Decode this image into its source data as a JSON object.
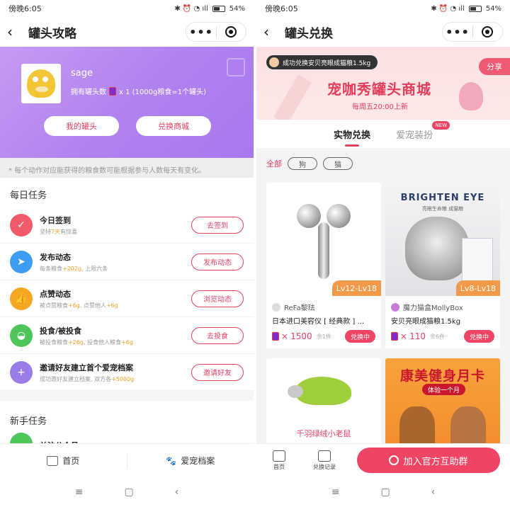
{
  "left": {
    "status": {
      "time": "傍晚6:05",
      "battery": "54%"
    },
    "nav": {
      "back_icon": "‹",
      "title": "罐头攻略",
      "more_icon": "•••"
    },
    "profile": {
      "username": "sage",
      "cans_text": "拥有罐头数",
      "cans_detail": "x 1 (1000g粮食=1个罐头)",
      "btn_my_cans": "我的罐头",
      "btn_shop": "兑换商城"
    },
    "notice": "* 每个动作对应能获得的粮食数可能根据参与人数每天有变化。",
    "daily_title": "每日任务",
    "tasks": [
      {
        "name": "今日签到",
        "desc_a": "坚持",
        "desc_hl": "7天",
        "desc_b": "有惊喜",
        "desc_hl2": "",
        "btn": "去签到",
        "color": "#f05a6b",
        "icon": "✓"
      },
      {
        "name": "发布动态",
        "desc_a": "每条粮食",
        "desc_hl": "+202g",
        "desc_b": ", 上限六条",
        "desc_hl2": "",
        "btn": "发布动态",
        "color": "#3d9df2",
        "icon": "➤"
      },
      {
        "name": "点赞动态",
        "desc_a": "被点赞粮食",
        "desc_hl": "+6g",
        "desc_b": ", 点赞他人",
        "desc_hl2": "+6g",
        "btn": "浏览动态",
        "color": "#f5a623",
        "icon": "👍"
      },
      {
        "name": "投食/被投食",
        "desc_a": "被投食粮食",
        "desc_hl": "+26g",
        "desc_b": ", 投食他人粮食",
        "desc_hl2": "+6g",
        "btn": "去投食",
        "color": "#4fc65a",
        "icon": "◒"
      },
      {
        "name": "邀请好友建立首个爱宠档案",
        "desc_a": "成功邀好友建立档案, 双方各",
        "desc_hl": "+5000g",
        "desc_b": "",
        "desc_hl2": "",
        "btn": "邀请好友",
        "color": "#9a7ce8",
        "icon": "+"
      }
    ],
    "newbie_title": "新手任务",
    "newbie_first": "关注公众号",
    "tabbar": {
      "home": "首页",
      "pets": "爱宠档案"
    }
  },
  "right": {
    "status": {
      "time": "傍晚6:05",
      "battery": "54%"
    },
    "nav": {
      "back_icon": "‹",
      "title": "罐头兑换",
      "more_icon": "•••"
    },
    "banner": {
      "toast": "成功兑换安贝亮眼成猫粮1.5kg",
      "share": "分享",
      "title": "宠咖秀罐头商城",
      "subtitle": "每周五20:00上新"
    },
    "tabs": {
      "physical": "实物兑换",
      "decor": "爱宠装扮",
      "new_badge": "NEW"
    },
    "filters": {
      "all": "全部",
      "dog": "狗",
      "cat": "猫"
    },
    "products": [
      {
        "level": "Lv12-Lv18",
        "brand": "ReFa黎珐",
        "name": "日本进口美容仪 [ 经典款 ] ...",
        "price": "1500",
        "stock": "余1件",
        "btn": "兑换中"
      },
      {
        "level": "Lv8-Lv18",
        "brand": "魔力猫盒MollyBox",
        "name": "安贝亮眼成猫粮1.5kg",
        "price": "110",
        "stock": "余6件",
        "btn": "兑换中",
        "img_brand": "BRIGHTEN EYE",
        "img_sub": "亮眼生命粮 成猫粮"
      }
    ],
    "mouse_label": "千羽绿绒小老鼠",
    "gym": {
      "title": "康美健身月卡",
      "sub": "体验一个月"
    },
    "bottom": {
      "home": "首页",
      "records": "兑换记录",
      "join": "加入官方互助群"
    }
  },
  "sysnav": {
    "menu": "≡",
    "home": "▢",
    "back": "‹"
  }
}
